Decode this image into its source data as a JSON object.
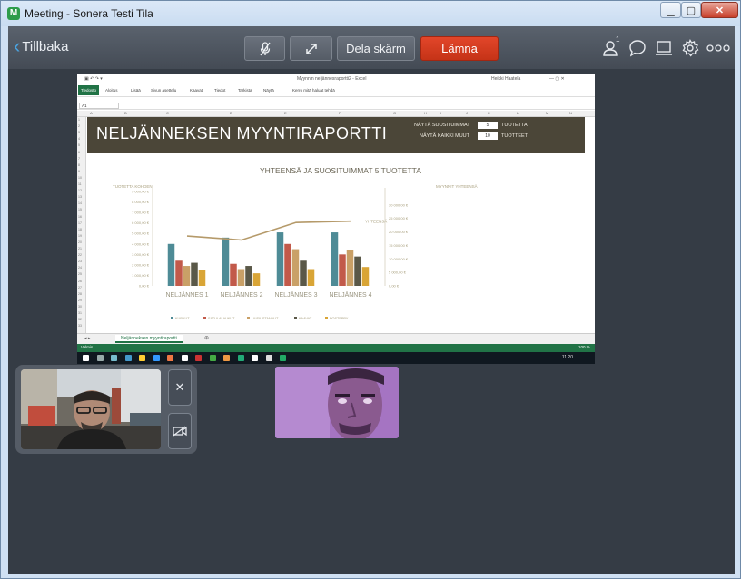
{
  "window": {
    "title": "Meeting - Sonera Testi Tila",
    "app_icon": "M",
    "minimize": "▁",
    "maximize": "▢",
    "close": "✕"
  },
  "toolbar": {
    "back_label": "Tillbaka",
    "share_label": "Dela skärm",
    "leave_label": "Lämna",
    "participants_count": "1",
    "leave_color": "#d23a1e"
  },
  "shared_screen": {
    "excel_title": "Myynnin neljännesraportti2 - Excel",
    "excel_user": "Heikki Haatela",
    "ribbon_tabs": [
      "Tiedosto",
      "Aloitus",
      "Lisää",
      "Sivun asettelu",
      "Kaavat",
      "Tiedot",
      "Tarkista",
      "Näytä"
    ],
    "tell_me": "Kerro mitä haluat tehdä",
    "name_box": "A1",
    "columns": [
      "A",
      "B",
      "C",
      "D",
      "E",
      "F",
      "G",
      "H",
      "I",
      "J",
      "K",
      "L",
      "M",
      "N"
    ],
    "rows": [
      "1",
      "2",
      "3",
      "4",
      "5",
      "6",
      "7",
      "8",
      "9",
      "10",
      "11",
      "12",
      "13",
      "14",
      "15",
      "16",
      "17",
      "18",
      "19",
      "20",
      "21",
      "22",
      "23",
      "24",
      "25",
      "26",
      "27",
      "28",
      "29",
      "30",
      "31",
      "32",
      "33"
    ],
    "report_title": "NELJÄNNEKSEN MYYNTIRAPORTTI",
    "show_top_label": "NÄYTÄ SUOSITUIMMAT",
    "show_top_value": "5",
    "show_top_unit": "TUOTETTA",
    "show_all_label": "NÄYTÄ KAIKKI MUUT",
    "show_all_value": "10",
    "show_all_unit": "TUOTTEET",
    "sheet_tab": "Neljänneksen myyntiraportti",
    "status_left": "Valmis",
    "zoom": "100 %",
    "clock": "11.20"
  },
  "chart_data": {
    "type": "bar",
    "title": "YHTEENSÄ JA SUOSITUIMMAT 5 TUOTETTA",
    "ylabel": "TUOTETTA KOHDEN",
    "y2label": "MYYNNIT YHTEENSÄ",
    "line_label": "YHTEENSÄ",
    "categories": [
      "NELJÄNNES 1",
      "NELJÄNNES 2",
      "NELJÄNNES 3",
      "NELJÄNNES 4"
    ],
    "ylim": [
      0,
      9000
    ],
    "yticks": [
      "0,00 €",
      "1 000,00 €",
      "2 000,00 €",
      "3 000,00 €",
      "4 000,00 €",
      "5 000,00 €",
      "6 000,00 €",
      "7 000,00 €",
      "8 000,00 €",
      "9 000,00 €"
    ],
    "y2lim": [
      0,
      35000
    ],
    "y2ticks": [
      "0,00 €",
      "5 000,00 €",
      "10 000,00 €",
      "15 000,00 €",
      "20 000,00 €",
      "25 000,00 €",
      "30 000,00 €"
    ],
    "series": [
      {
        "name": "KURKUT",
        "color": "#4e8b96",
        "values": [
          4000,
          4600,
          5100,
          5100
        ]
      },
      {
        "name": "SATULALAUKUT",
        "color": "#c25a4a",
        "values": [
          2400,
          2100,
          4000,
          3000
        ]
      },
      {
        "name": "UUSIUSTANNUT",
        "color": "#c9a067",
        "values": [
          1900,
          1600,
          3500,
          3400
        ]
      },
      {
        "name": "KAAVAT",
        "color": "#5a5848",
        "values": [
          2200,
          1900,
          2400,
          2800
        ]
      },
      {
        "name": "POSTEPPY",
        "color": "#d9a536",
        "values": [
          1500,
          1200,
          1600,
          1800
        ]
      }
    ],
    "total_line": {
      "name": "YHTEENSÄ",
      "color": "#b59a6a",
      "values": [
        18500,
        17000,
        23500,
        24000
      ]
    },
    "legend_position": "bottom",
    "grid": false
  },
  "icons": {
    "mic": "microphone-off-icon",
    "expand": "expand-icon",
    "people": "participants-icon",
    "chat": "chat-icon",
    "screen": "screen-share-icon",
    "gear": "gear-icon",
    "more": "more-icon",
    "close": "close-icon",
    "camera": "camera-off-icon"
  }
}
